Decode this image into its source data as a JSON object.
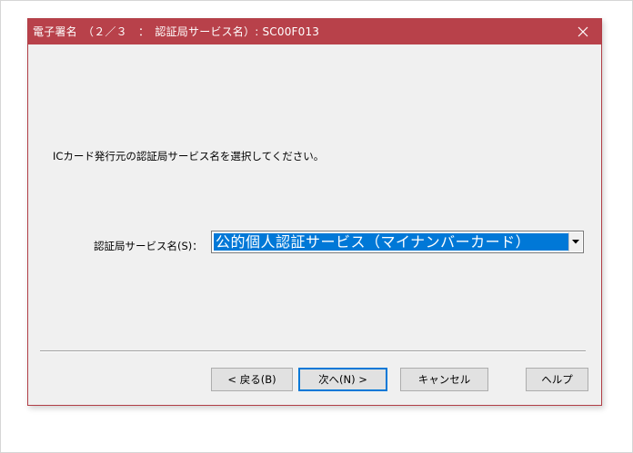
{
  "window": {
    "title": "電子署名　（２／３　：　認証局サービス名）: SC00F013",
    "close_icon": "close-icon",
    "titlebar_color": "#b8414a"
  },
  "main": {
    "instruction": "ICカード発行元の認証局サービス名を選択してください。",
    "service_label": "認証局サービス名(S)：",
    "service_select": {
      "selected": "公的個人認証サービス（マイナンバーカード）",
      "arrow_icon": "chevron-down-icon"
    }
  },
  "buttons": {
    "back": "< 戻る(B)",
    "next": "次へ(N) >",
    "cancel": "キャンセル",
    "help": "ヘルプ"
  },
  "colors": {
    "selection": "#0078d7",
    "dialog_bg": "#f0f0f0"
  }
}
